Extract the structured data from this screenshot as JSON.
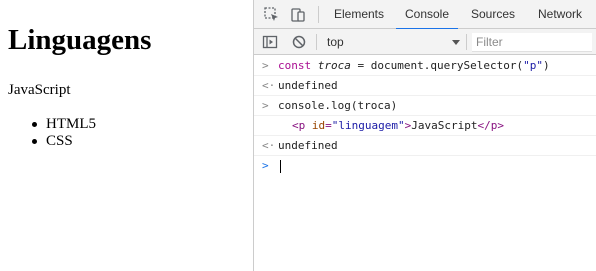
{
  "page": {
    "heading": "Linguagens",
    "paragraph": "JavaScript",
    "list": [
      "HTML5",
      "CSS"
    ]
  },
  "devtools": {
    "tabs": [
      "Elements",
      "Console",
      "Sources",
      "Network"
    ],
    "active_tab": "Console",
    "icons": [
      "inspect-element-icon",
      "device-toolbar-icon",
      "sidebar-toggle-icon",
      "clear-console-icon"
    ],
    "context": "top",
    "filter_placeholder": "Filter",
    "accent_color": "#1a73e8"
  },
  "console": {
    "input_prompt": ">",
    "result_prompt": "<·",
    "line1": {
      "kw": "const",
      "var": "troca",
      "op": " = ",
      "expr": "document.querySelector(",
      "arg": "\"p\"",
      "close": ")"
    },
    "line2": "undefined",
    "line3": "console.log(troca)",
    "line4": {
      "open": "<p",
      "attr_name": "id",
      "eq": "=",
      "attr_val": "\"linguagem\"",
      "gt": ">",
      "text": "JavaScript",
      "close": "</p>"
    },
    "line5": "undefined"
  }
}
